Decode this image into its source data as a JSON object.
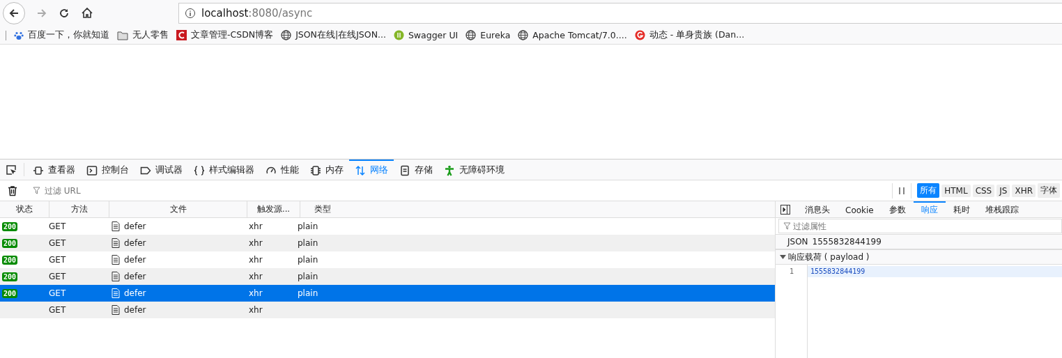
{
  "address_bar": {
    "host": "localhost",
    "path": ":8080/async"
  },
  "bookmarks": [
    {
      "label": "百度一下，你就知道"
    },
    {
      "label": "无人零售"
    },
    {
      "label": "文章管理-CSDN博客"
    },
    {
      "label": "JSON在线|在线JSON..."
    },
    {
      "label": "Swagger UI"
    },
    {
      "label": "Eureka"
    },
    {
      "label": "Apache Tomcat/7.0...."
    },
    {
      "label": "动态 - 单身贵族 (Dan..."
    }
  ],
  "devtools_tabs": [
    {
      "label": "查看器",
      "selected": false
    },
    {
      "label": "控制台",
      "selected": false
    },
    {
      "label": "调试器",
      "selected": false
    },
    {
      "label": "样式编辑器",
      "selected": false
    },
    {
      "label": "性能",
      "selected": false
    },
    {
      "label": "内存",
      "selected": false
    },
    {
      "label": "网络",
      "selected": true
    },
    {
      "label": "存储",
      "selected": false
    },
    {
      "label": "无障碍环境",
      "selected": false
    }
  ],
  "url_filter": {
    "placeholder": "过滤 URL"
  },
  "type_filters": [
    {
      "label": "所有",
      "selected": true
    },
    {
      "label": "HTML",
      "selected": false
    },
    {
      "label": "CSS",
      "selected": false
    },
    {
      "label": "JS",
      "selected": false
    },
    {
      "label": "XHR",
      "selected": false
    },
    {
      "label": "字体",
      "selected": false
    }
  ],
  "table": {
    "columns": [
      "状态",
      "方法",
      "文件",
      "触发源...",
      "类型"
    ],
    "rows": [
      {
        "status": "200",
        "method": "GET",
        "file": "defer",
        "cause": "xhr",
        "type": "plain",
        "selected": false
      },
      {
        "status": "200",
        "method": "GET",
        "file": "defer",
        "cause": "xhr",
        "type": "plain",
        "selected": false
      },
      {
        "status": "200",
        "method": "GET",
        "file": "defer",
        "cause": "xhr",
        "type": "plain",
        "selected": false
      },
      {
        "status": "200",
        "method": "GET",
        "file": "defer",
        "cause": "xhr",
        "type": "plain",
        "selected": false
      },
      {
        "status": "200",
        "method": "GET",
        "file": "defer",
        "cause": "xhr",
        "type": "plain",
        "selected": true
      },
      {
        "method": "GET",
        "file": "defer",
        "cause": "xhr",
        "selected": false
      }
    ]
  },
  "details": {
    "tabs": [
      {
        "label": "消息头",
        "selected": false
      },
      {
        "label": "Cookie",
        "selected": false
      },
      {
        "label": "参数",
        "selected": false
      },
      {
        "label": "响应",
        "selected": true
      },
      {
        "label": "耗时",
        "selected": false
      },
      {
        "label": "堆栈跟踪",
        "selected": false
      }
    ],
    "filter": {
      "placeholder": "过滤属性"
    },
    "json_label": "JSON",
    "json_value": "1555832844199",
    "payload_header": "响应载荷 ( payload )",
    "lines": [
      {
        "number": "1",
        "text": "1555832844199"
      }
    ]
  }
}
